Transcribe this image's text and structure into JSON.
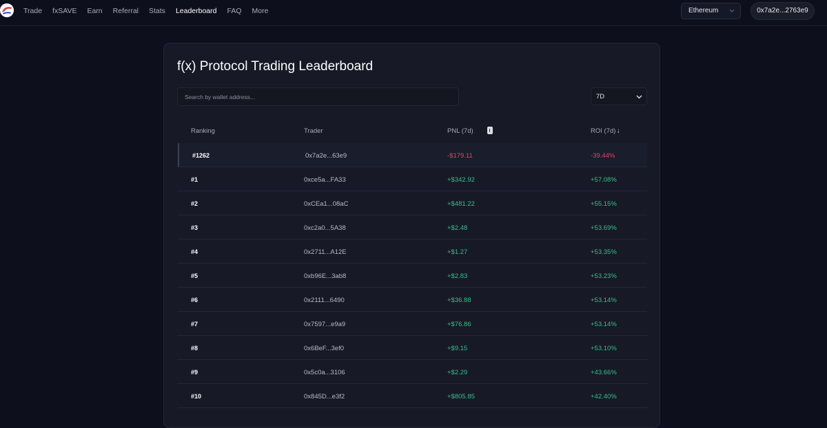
{
  "nav": {
    "items": [
      "Trade",
      "fxSAVE",
      "Earn",
      "Referral",
      "Stats",
      "Leaderboard",
      "FAQ",
      "More"
    ],
    "active": "Leaderboard"
  },
  "network": {
    "selected": "Ethereum"
  },
  "wallet": {
    "address": "0x7a2e...2763e9"
  },
  "page": {
    "title": "f(x) Protocol Trading Leaderboard"
  },
  "search": {
    "placeholder": "Search by wallet address..."
  },
  "period": {
    "selected": "7D"
  },
  "table": {
    "headers": {
      "ranking": "Ranking",
      "trader": "Trader",
      "pnl": "PNL (7d)",
      "roi": "ROI (7d)",
      "roi_sort": "↓"
    },
    "rows": [
      {
        "rank": "#1262",
        "trader": "0x7a2e...63e9",
        "pnl": "-$179.11",
        "roi": "-39.44%",
        "self": true
      },
      {
        "rank": "#1",
        "trader": "0xce5a...FA33",
        "pnl": "+$342.92",
        "roi": "+57.08%"
      },
      {
        "rank": "#2",
        "trader": "0xCEa1...08aC",
        "pnl": "+$481.22",
        "roi": "+55.15%"
      },
      {
        "rank": "#3",
        "trader": "0xc2a0...5A38",
        "pnl": "+$2.48",
        "roi": "+53.69%"
      },
      {
        "rank": "#4",
        "trader": "0x2711...A12E",
        "pnl": "+$1.27",
        "roi": "+53.35%"
      },
      {
        "rank": "#5",
        "trader": "0xb96E...3ab8",
        "pnl": "+$2.83",
        "roi": "+53.23%"
      },
      {
        "rank": "#6",
        "trader": "0x2111...6490",
        "pnl": "+$36.88",
        "roi": "+53.14%"
      },
      {
        "rank": "#7",
        "trader": "0x7597...e9a9",
        "pnl": "+$76.86",
        "roi": "+53.14%"
      },
      {
        "rank": "#8",
        "trader": "0x6BeF...3ef0",
        "pnl": "+$9.15",
        "roi": "+53.10%"
      },
      {
        "rank": "#9",
        "trader": "0x5c0a...3106",
        "pnl": "+$2.29",
        "roi": "+43.66%"
      },
      {
        "rank": "#10",
        "trader": "0x845D...e3f2",
        "pnl": "+$805.85",
        "roi": "+42.40%"
      }
    ]
  },
  "colors": {
    "positive": "#3bbd8a",
    "negative": "#e0476b",
    "background": "#0d0f1c",
    "card": "#171a26"
  },
  "icons": {
    "logo": "fx-logo-icon",
    "network_chevron": "chevron-down-icon",
    "period_chevron": "chevron-down-icon",
    "pnl_sort": "sort-toggle-icon",
    "roi_sort": "arrow-down-icon"
  }
}
